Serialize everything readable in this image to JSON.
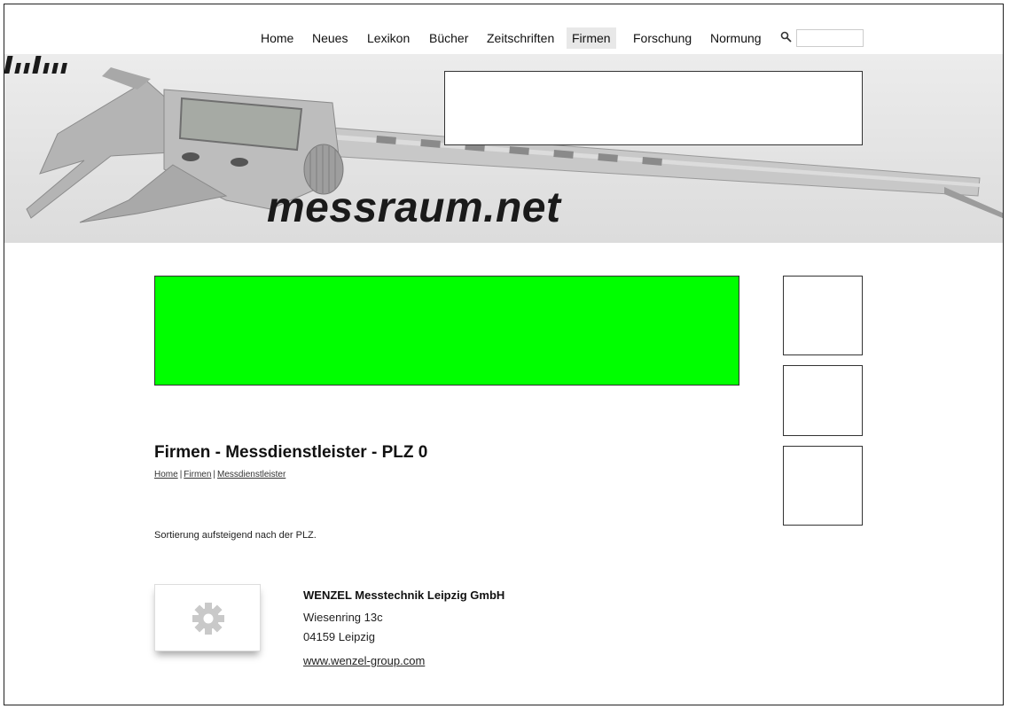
{
  "nav": {
    "items": [
      {
        "label": "Home"
      },
      {
        "label": "Neues"
      },
      {
        "label": "Lexikon"
      },
      {
        "label": "Bücher"
      },
      {
        "label": "Zeitschriften"
      },
      {
        "label": "Firmen",
        "active": true
      },
      {
        "label": "Forschung"
      },
      {
        "label": "Normung"
      }
    ],
    "search": {
      "icon": "search-icon",
      "placeholder": ""
    }
  },
  "logo": {
    "text": "messraum.net"
  },
  "page": {
    "title": "Firmen - Messdienstleister - PLZ 0",
    "breadcrumb": [
      {
        "label": "Home"
      },
      {
        "label": "Firmen"
      },
      {
        "label": "Messdienstleister"
      }
    ],
    "breadcrumb_separator": "|",
    "sort_note": "Sortierung aufsteigend nach der PLZ."
  },
  "companies": [
    {
      "name": "WENZEL Messtechnik Leipzig GmbH",
      "street": "Wiesenring 13c",
      "city": "04159 Leipzig",
      "website": "www.wenzel-group.com",
      "logo_icon": "gear-icon"
    }
  ],
  "colors": {
    "banner_ad": "#00ff00",
    "nav_active_bg": "#e8e8e8"
  }
}
